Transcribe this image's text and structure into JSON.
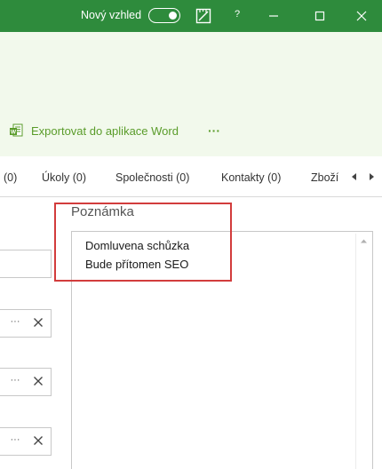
{
  "titlebar": {
    "new_view_label": "Nový vzhled",
    "toggle_on": true,
    "help_label": "?",
    "bg_color": "#2e8b3c"
  },
  "ribbon": {
    "export_label": "Exportovat do aplikace Word",
    "more_label": "···",
    "accent_color": "#5a9c2a"
  },
  "tabs": {
    "items": [
      {
        "label": "(0)"
      },
      {
        "label": "Úkoly (0)"
      },
      {
        "label": "Společnosti (0)"
      },
      {
        "label": "Kontakty (0)"
      },
      {
        "label": "Zboží"
      }
    ]
  },
  "fields": {
    "more_label": "···"
  },
  "note": {
    "label": "Poznámka",
    "lines": [
      "Domluvena schůzka",
      "Bude přítomen SEO"
    ]
  },
  "highlight_color": "#d23c3c"
}
